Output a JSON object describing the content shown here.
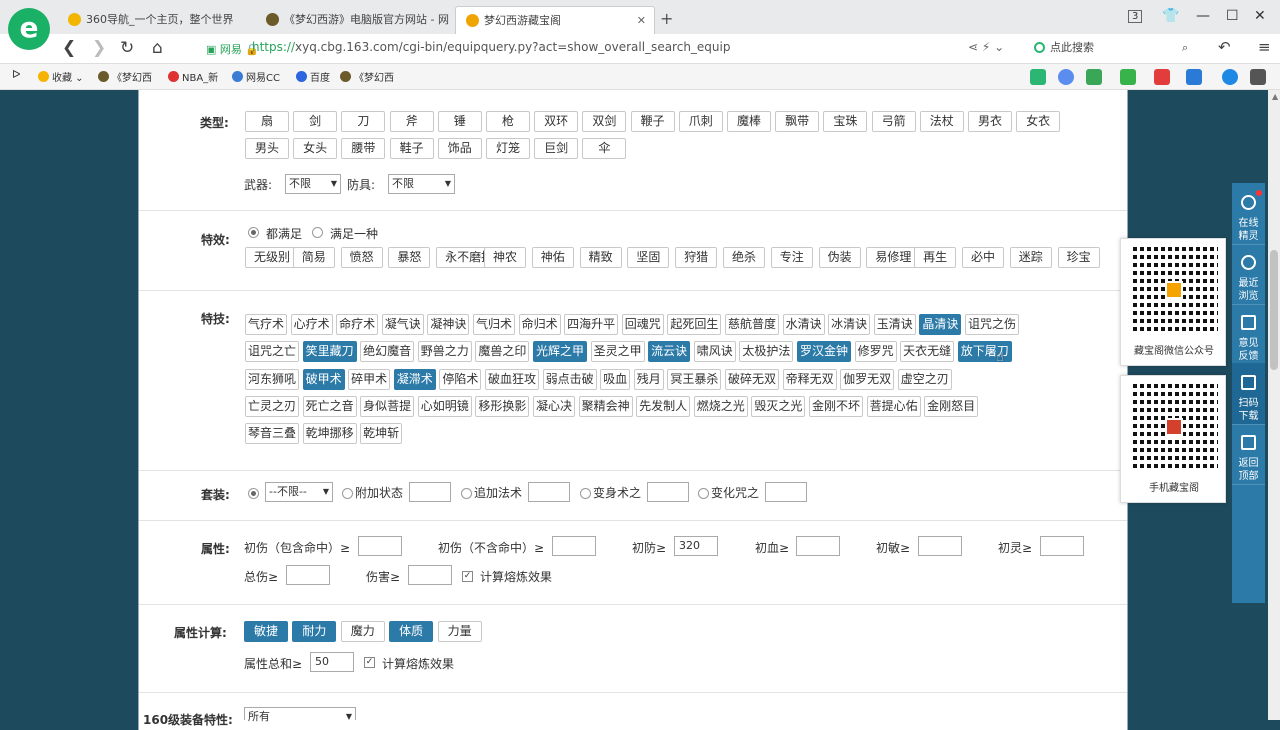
{
  "browser": {
    "tabs": [
      {
        "label": "360导航_一个主页，整个世界"
      },
      {
        "label": "《梦幻西游》电脑版官方网站 - 网"
      },
      {
        "label": "梦幻西游藏宝阁"
      }
    ],
    "url_site": "网易",
    "url_scheme": "https://",
    "url_rest": "xyq.cbg.163.com/cgi-bin/equipquery.py?act=show_overall_search_equip",
    "search_placeholder": "点此搜索",
    "bookmarks": [
      "收藏",
      "《梦幻西",
      "NBA_新",
      "网易CC",
      "百度",
      "《梦幻西"
    ],
    "tab_count": "3"
  },
  "form": {
    "type_label": "类型:",
    "types": [
      "扇",
      "剑",
      "刀",
      "斧",
      "锤",
      "枪",
      "双环",
      "双剑",
      "鞭子",
      "爪刺",
      "魔棒",
      "飘带",
      "宝珠",
      "弓箭",
      "法杖",
      "男衣",
      "女衣",
      "男头",
      "女头",
      "腰带",
      "鞋子",
      "饰品",
      "灯笼",
      "巨剑",
      "伞"
    ],
    "weapon_label": "武器:",
    "weapon_value": "不限",
    "armor_label": "防具:",
    "armor_value": "不限",
    "effect_label": "特效:",
    "effect_mode": [
      "都满足",
      "满足一种"
    ],
    "effects": [
      "无级别",
      "简易",
      "愤怒",
      "暴怒",
      "永不磨损",
      "神农",
      "神佑",
      "精致",
      "坚固",
      "狩猎",
      "绝杀",
      "专注",
      "伪装",
      "易修理",
      "再生",
      "必中",
      "迷踪",
      "珍宝"
    ],
    "skill_label": "特技:",
    "skills": [
      [
        "气疗术",
        "心疗术",
        "命疗术",
        "凝气诀",
        "凝神诀",
        "气归术",
        "命归术",
        "四海升平",
        "回魂咒",
        "起死回生",
        "慈航普度",
        "水清诀",
        "冰清诀",
        "玉清诀",
        "晶清诀",
        "诅咒之伤"
      ],
      [
        "诅咒之亡",
        "笑里藏刀",
        "绝幻魔音",
        "野兽之力",
        "魔兽之印",
        "光辉之甲",
        "圣灵之甲",
        "流云诀",
        "啸风诀",
        "太极护法",
        "罗汉金钟",
        "修罗咒",
        "天衣无缝",
        "放下屠刀"
      ],
      [
        "河东狮吼",
        "破甲术",
        "碎甲术",
        "凝滞术",
        "停陷术",
        "破血狂攻",
        "弱点击破",
        "吸血",
        "残月",
        "冥王暴杀",
        "破碎无双",
        "帝释无双",
        "伽罗无双",
        "虚空之刃"
      ],
      [
        "亡灵之刃",
        "死亡之音",
        "身似菩提",
        "心如明镜",
        "移形换影",
        "凝心决",
        "聚精会神",
        "先发制人",
        "燃烧之光",
        "毁灭之光",
        "金刚不坏",
        "菩提心佑",
        "金刚怒目"
      ],
      [
        "琴音三叠",
        "乾坤挪移",
        "乾坤斩"
      ]
    ],
    "skills_on": [
      "晶清诀",
      "笑里藏刀",
      "光辉之甲",
      "流云诀",
      "罗汉金钟",
      "放下屠刀",
      "破甲术",
      "凝滞术"
    ],
    "suit_label": "套装:",
    "suit_value": "--不限--",
    "suit_opts": [
      "附加状态",
      "追加法术",
      "变身术之",
      "变化咒之"
    ],
    "attr_label": "属性:",
    "attrs": [
      {
        "label": "初伤（包含命中）≥",
        "value": ""
      },
      {
        "label": "初伤（不含命中）≥",
        "value": ""
      },
      {
        "label": "初防≥",
        "value": "320"
      },
      {
        "label": "初血≥",
        "value": ""
      },
      {
        "label": "初敏≥",
        "value": ""
      },
      {
        "label": "初灵≥",
        "value": ""
      },
      {
        "label": "总伤≥",
        "value": ""
      },
      {
        "label": "伤害≥",
        "value": ""
      }
    ],
    "calc_refine": "计算熔炼效果",
    "attrcalc_label": "属性计算:",
    "attrcalc": [
      "敏捷",
      "耐力",
      "魔力",
      "体质",
      "力量"
    ],
    "attrcalc_on": [
      "敏捷",
      "耐力",
      "体质"
    ],
    "attr_sum_label": "属性总和≥",
    "attr_sum_value": "50",
    "lv160_label": "160级装备特性:",
    "lv160_value": "所有"
  },
  "side": {
    "items": [
      "在线精灵",
      "最近浏览",
      "意见反馈",
      "扫码下载",
      "返回顶部"
    ],
    "qr1": "藏宝阁微信公众号",
    "qr2": "手机藏宝阁"
  }
}
